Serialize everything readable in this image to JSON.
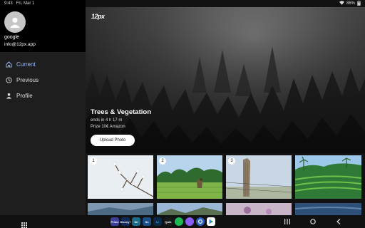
{
  "status_bar": {
    "time": "9:43",
    "date": "Fri, Mar 1",
    "battery": "86%"
  },
  "drawer": {
    "account_name": "google",
    "account_email": "info@12px.app",
    "items": [
      {
        "label": "Current",
        "icon": "home-icon",
        "active": true
      },
      {
        "label": "Previous",
        "icon": "history-icon",
        "active": false
      },
      {
        "label": "Profile",
        "icon": "person-icon",
        "active": false
      }
    ]
  },
  "hero": {
    "logo_text": "12px",
    "title": "Trees & Vegetation",
    "time_left": "ends in 4 h 17 m",
    "prize": "Prize 10€ Amazon",
    "upload_label": "Upload Photo"
  },
  "photos": [
    {
      "rank": "1",
      "subject": "blossom-branch-photo"
    },
    {
      "rank": "2",
      "subject": "rice-field-photo"
    },
    {
      "rank": "3",
      "subject": "fence-post-photo"
    },
    {
      "rank": "",
      "subject": "rice-terraces-photo"
    }
  ],
  "taskbar": {
    "apps": [
      {
        "label": "Prime",
        "icon": "prime-video-icon",
        "color": "#3b3f9a"
      },
      {
        "label": "Disney+",
        "icon": "disney-plus-icon",
        "color": "#102a5a"
      },
      {
        "label": "Sn",
        "icon": "samsung-notes-icon",
        "color": "#1c6b8a"
      },
      {
        "label": "Sn",
        "icon": "samsung-app-icon",
        "color": "#1b4f8a"
      },
      {
        "label": "Lr",
        "icon": "lightroom-icon",
        "color": "#0a2a4a"
      },
      {
        "label": "Quik",
        "icon": "quik-icon",
        "color": "#1a1a1a"
      },
      {
        "label": "",
        "icon": "spotify-icon",
        "color": "#1db954"
      },
      {
        "label": "",
        "icon": "messenger-icon",
        "color": "#8a5cf6"
      },
      {
        "label": "",
        "icon": "settings-icon",
        "color": "#2d5fbf"
      },
      {
        "label": "",
        "icon": "play-store-icon",
        "color": "#ffffff"
      }
    ]
  }
}
